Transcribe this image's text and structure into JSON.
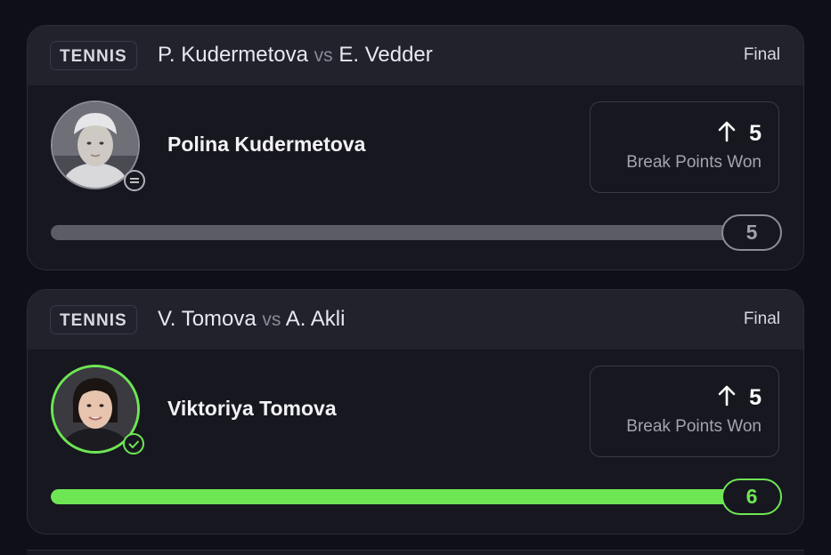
{
  "cards": [
    {
      "sport": "TENNIS",
      "player1": "P. Kudermetova",
      "vs": "vs",
      "player2": "E. Vedder",
      "status": "Final",
      "player_name": "Polina Kudermetova",
      "badge_icon": "pending-icon",
      "stat_direction_icon": "arrow-up-icon",
      "stat_line": "5",
      "stat_label": "Break Points Won",
      "result_value": "5",
      "progress_fraction": 1.0,
      "accent_color": "#5c5c66"
    },
    {
      "sport": "TENNIS",
      "player1": "V. Tomova",
      "vs": "vs",
      "player2": "A. Akli",
      "status": "Final",
      "player_name": "Viktoriya Tomova",
      "badge_icon": "check-icon",
      "stat_direction_icon": "arrow-up-icon",
      "stat_line": "5",
      "stat_label": "Break Points Won",
      "result_value": "6",
      "progress_fraction": 1.0,
      "accent_color": "#6ee654"
    }
  ]
}
